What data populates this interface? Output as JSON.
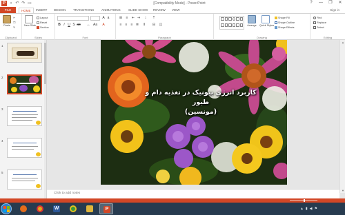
{
  "window": {
    "title": "[Compatibility Mode] - PowerPoint",
    "app_icon": "P",
    "controls": [
      "?",
      "—",
      "❐",
      "✕"
    ]
  },
  "quick_access": [
    "save-icon",
    "undo-icon",
    "redo-icon",
    "present-icon"
  ],
  "ribbon_tabs": [
    "FILE",
    "HOME",
    "INSERT",
    "DESIGN",
    "TRANSITIONS",
    "ANIMATIONS",
    "SLIDE SHOW",
    "REVIEW",
    "VIEW"
  ],
  "account": {
    "signin": "Sign in"
  },
  "ribbon": {
    "clipboard": {
      "label": "Clipboard",
      "paste": "Paste"
    },
    "slides": {
      "label": "Slides",
      "new_slide": "New Slide",
      "layout": "Layout",
      "reset": "Reset",
      "section": "Section"
    },
    "font": {
      "label": "Font",
      "font_name": "",
      "font_size": ""
    },
    "paragraph": {
      "label": "Paragraph"
    },
    "drawing": {
      "label": "Drawing",
      "arrange": "Arrange",
      "quick_styles": "Quick Styles",
      "shape_fill": "Shape Fill",
      "shape_outline": "Shape Outline",
      "shape_effects": "Shape Effects"
    },
    "editing": {
      "label": "Editing",
      "find": "Find",
      "replace": "Replace",
      "select": "Select"
    }
  },
  "thumbnails": [
    {
      "number": "1",
      "style": "calligraphy"
    },
    {
      "number": "2",
      "style": "flowers",
      "selected": true
    },
    {
      "number": "3",
      "style": "text"
    },
    {
      "number": "4",
      "style": "text"
    },
    {
      "number": "5",
      "style": "text"
    }
  ],
  "slide": {
    "title_line1": "کاربرد انرژی بیونیک در تغذیه دام و طیور",
    "title_line2": "(مونسین)"
  },
  "notes": {
    "placeholder": "Click to add notes"
  },
  "taskbar": {
    "apps": [
      {
        "name": "windows-media-icon",
        "color": "#e46c1b"
      },
      {
        "name": "chrome-icon",
        "color": "#e0a918"
      },
      {
        "name": "word-icon",
        "color": "#2b5797",
        "glyph": "W"
      },
      {
        "name": "chrome-icon-2",
        "color": "#3a9a3a"
      },
      {
        "name": "file-explorer-icon",
        "color": "#e0b53c"
      },
      {
        "name": "powerpoint-icon",
        "color": "#d24726",
        "glyph": "P",
        "active": true
      }
    ],
    "clock_time": "",
    "clock_date": ""
  },
  "colors": {
    "accent": "#d24726",
    "taskbar": "#273b4f"
  }
}
